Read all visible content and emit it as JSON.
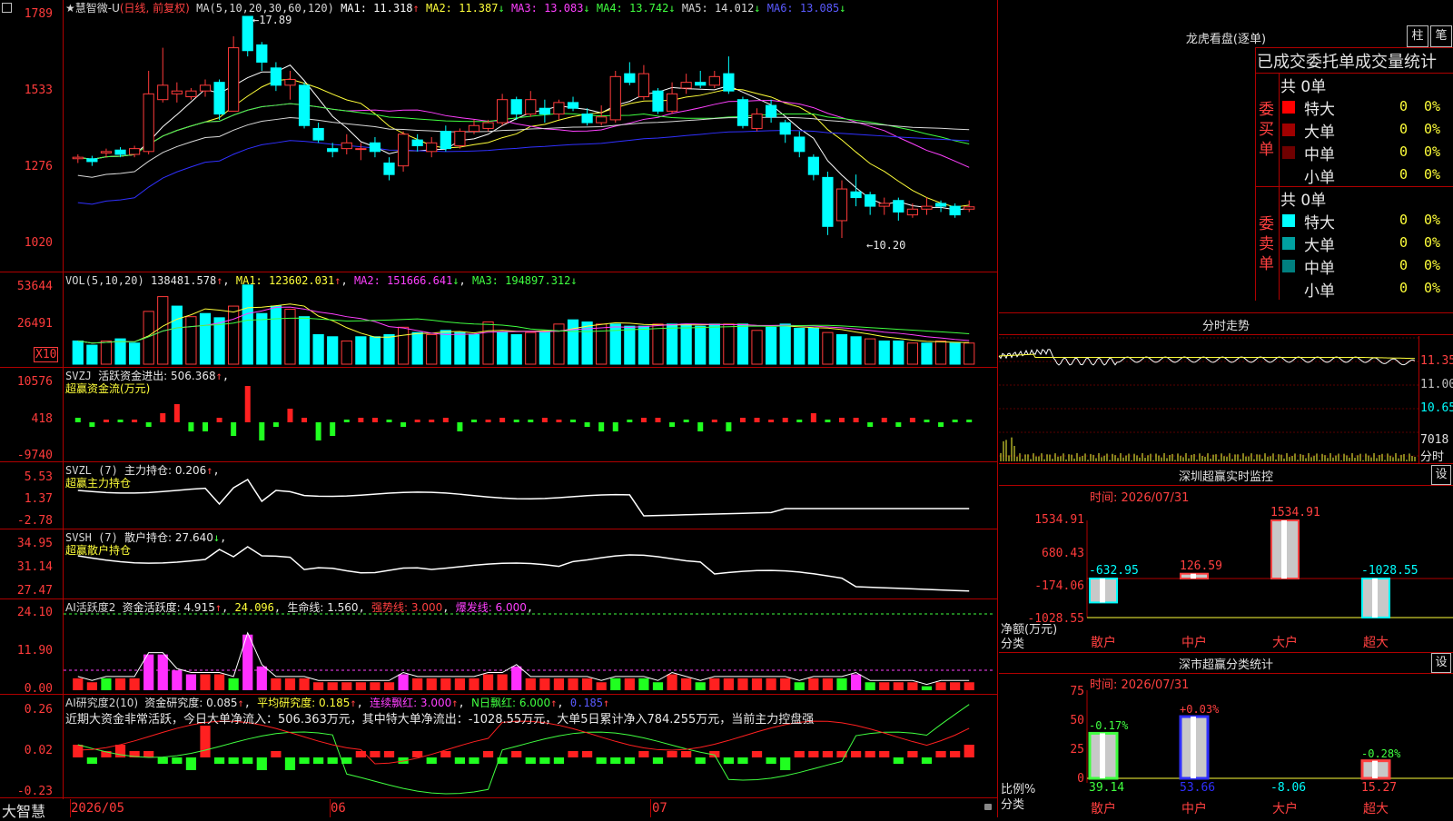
{
  "main": {
    "stock_title": "★慧智微-U",
    "stock_mode": "(日线, 前复权)",
    "ma_header": "MA(5,10,20,30,60,120)",
    "ma_values": [
      {
        "label": "MA1: 11.318",
        "arrow": "↑",
        "color": "#ffffff"
      },
      {
        "label": "MA2: 11.387",
        "arrow": "↓",
        "color": "#ffff3a"
      },
      {
        "label": "MA3: 13.083",
        "arrow": "↓",
        "color": "#ff40ff"
      },
      {
        "label": "MA4: 13.742",
        "arrow": "↓",
        "color": "#40ff40"
      },
      {
        "label": "MA5: 14.012",
        "arrow": "↓",
        "color": "#d8d8d8"
      },
      {
        "label": "MA6: 13.085",
        "arrow": "↓",
        "color": "#5a5aff"
      }
    ],
    "y_ticks": [
      "1789",
      "1533",
      "1276",
      "1020"
    ],
    "high_marker": "←17.89",
    "low_marker": "←10.20",
    "candles": [
      {
        "o": 12.95,
        "c": 13.0,
        "h": 13.1,
        "l": 12.8
      },
      {
        "o": 12.95,
        "c": 12.85,
        "h": 13.05,
        "l": 12.7
      },
      {
        "o": 13.15,
        "c": 13.2,
        "h": 13.3,
        "l": 13.0
      },
      {
        "o": 13.25,
        "c": 13.1,
        "h": 13.35,
        "l": 13.0
      },
      {
        "o": 13.1,
        "c": 13.3,
        "h": 13.4,
        "l": 13.0
      },
      {
        "o": 13.2,
        "c": 15.2,
        "h": 16.0,
        "l": 13.1
      },
      {
        "o": 15.0,
        "c": 15.5,
        "h": 16.8,
        "l": 14.9
      },
      {
        "o": 15.2,
        "c": 15.3,
        "h": 15.6,
        "l": 14.9
      },
      {
        "o": 15.1,
        "c": 15.3,
        "h": 15.4,
        "l": 15.0
      },
      {
        "o": 15.3,
        "c": 15.5,
        "h": 15.7,
        "l": 15.1
      },
      {
        "o": 15.6,
        "c": 14.5,
        "h": 15.7,
        "l": 14.3
      },
      {
        "o": 14.6,
        "c": 16.8,
        "h": 17.2,
        "l": 14.6
      },
      {
        "o": 17.89,
        "c": 16.7,
        "h": 17.89,
        "l": 16.5
      },
      {
        "o": 16.9,
        "c": 16.3,
        "h": 17.0,
        "l": 16.0
      },
      {
        "o": 16.1,
        "c": 15.5,
        "h": 16.3,
        "l": 15.3
      },
      {
        "o": 15.5,
        "c": 15.7,
        "h": 16.0,
        "l": 15.0
      },
      {
        "o": 15.5,
        "c": 14.1,
        "h": 15.6,
        "l": 14.0
      },
      {
        "o": 14.0,
        "c": 13.6,
        "h": 14.2,
        "l": 13.5
      },
      {
        "o": 13.3,
        "c": 13.2,
        "h": 13.5,
        "l": 13.0
      },
      {
        "o": 13.3,
        "c": 13.5,
        "h": 13.8,
        "l": 13.1
      },
      {
        "o": 13.3,
        "c": 13.3,
        "h": 13.5,
        "l": 12.9
      },
      {
        "o": 13.5,
        "c": 13.2,
        "h": 13.7,
        "l": 13.0
      },
      {
        "o": 12.8,
        "c": 12.4,
        "h": 13.0,
        "l": 12.2
      },
      {
        "o": 12.7,
        "c": 13.8,
        "h": 13.9,
        "l": 12.5
      },
      {
        "o": 13.6,
        "c": 13.4,
        "h": 13.8,
        "l": 13.2
      },
      {
        "o": 13.2,
        "c": 13.5,
        "h": 13.7,
        "l": 13.0
      },
      {
        "o": 13.9,
        "c": 13.3,
        "h": 14.1,
        "l": 13.2
      },
      {
        "o": 13.4,
        "c": 13.9,
        "h": 14.0,
        "l": 13.3
      },
      {
        "o": 13.9,
        "c": 14.1,
        "h": 14.3,
        "l": 13.8
      },
      {
        "o": 14.0,
        "c": 14.2,
        "h": 14.3,
        "l": 13.9
      },
      {
        "o": 14.2,
        "c": 15.0,
        "h": 15.2,
        "l": 14.1
      },
      {
        "o": 15.0,
        "c": 14.5,
        "h": 15.1,
        "l": 14.3
      },
      {
        "o": 14.5,
        "c": 15.0,
        "h": 15.3,
        "l": 14.4
      },
      {
        "o": 14.7,
        "c": 14.5,
        "h": 15.0,
        "l": 14.2
      },
      {
        "o": 14.5,
        "c": 14.9,
        "h": 15.0,
        "l": 14.3
      },
      {
        "o": 14.9,
        "c": 14.7,
        "h": 15.1,
        "l": 14.6
      },
      {
        "o": 14.5,
        "c": 14.2,
        "h": 14.7,
        "l": 14.1
      },
      {
        "o": 14.2,
        "c": 14.4,
        "h": 14.8,
        "l": 14.1
      },
      {
        "o": 14.3,
        "c": 15.8,
        "h": 16.0,
        "l": 14.2
      },
      {
        "o": 15.9,
        "c": 15.6,
        "h": 16.3,
        "l": 15.5
      },
      {
        "o": 15.1,
        "c": 15.9,
        "h": 16.2,
        "l": 15.0
      },
      {
        "o": 15.3,
        "c": 14.6,
        "h": 15.4,
        "l": 14.5
      },
      {
        "o": 14.6,
        "c": 15.2,
        "h": 15.6,
        "l": 14.5
      },
      {
        "o": 15.4,
        "c": 15.6,
        "h": 15.9,
        "l": 15.2
      },
      {
        "o": 15.6,
        "c": 15.5,
        "h": 16.0,
        "l": 15.4
      },
      {
        "o": 15.5,
        "c": 15.8,
        "h": 16.0,
        "l": 15.4
      },
      {
        "o": 15.9,
        "c": 15.3,
        "h": 16.5,
        "l": 15.2
      },
      {
        "o": 15.0,
        "c": 14.1,
        "h": 15.1,
        "l": 14.0
      },
      {
        "o": 14.0,
        "c": 14.5,
        "h": 14.7,
        "l": 13.9
      },
      {
        "o": 14.8,
        "c": 14.4,
        "h": 15.0,
        "l": 14.2
      },
      {
        "o": 14.2,
        "c": 13.8,
        "h": 14.3,
        "l": 13.5
      },
      {
        "o": 13.7,
        "c": 13.2,
        "h": 13.9,
        "l": 13.0
      },
      {
        "o": 13.0,
        "c": 12.4,
        "h": 13.1,
        "l": 12.2
      },
      {
        "o": 12.3,
        "c": 10.6,
        "h": 12.5,
        "l": 10.3
      },
      {
        "o": 10.8,
        "c": 11.9,
        "h": 12.2,
        "l": 10.2
      },
      {
        "o": 11.8,
        "c": 11.6,
        "h": 12.4,
        "l": 11.3
      },
      {
        "o": 11.7,
        "c": 11.3,
        "h": 11.8,
        "l": 11.0
      },
      {
        "o": 11.3,
        "c": 11.4,
        "h": 11.6,
        "l": 11.0
      },
      {
        "o": 11.5,
        "c": 11.1,
        "h": 11.6,
        "l": 10.8
      },
      {
        "o": 11.0,
        "c": 11.2,
        "h": 11.4,
        "l": 10.9
      },
      {
        "o": 11.2,
        "c": 11.3,
        "h": 11.6,
        "l": 11.0
      },
      {
        "o": 11.4,
        "c": 11.3,
        "h": 11.5,
        "l": 11.1
      },
      {
        "o": 11.3,
        "c": 11.0,
        "h": 11.4,
        "l": 10.9
      },
      {
        "o": 11.2,
        "c": 11.28,
        "h": 11.5,
        "l": 11.1
      }
    ]
  },
  "vol": {
    "header": "VOL(5,10,20)",
    "value": "138481.578",
    "value_arrow": "↑",
    "ma1": "MA1: 123602.031",
    "ma1_arrow": "↑",
    "ma2": "MA2: 151666.641",
    "ma2_arrow": "↓",
    "ma3": "MA3: 194897.312",
    "ma3_arrow": "↓",
    "y_ticks": [
      "53644",
      "26491"
    ],
    "unit": "X10",
    "bars": [
      22,
      18,
      22,
      24,
      20,
      50,
      64,
      55,
      45,
      48,
      44,
      55,
      75,
      48,
      55,
      52,
      45,
      28,
      26,
      22,
      26,
      26,
      28,
      35,
      30,
      28,
      32,
      30,
      28,
      40,
      30,
      28,
      30,
      30,
      38,
      42,
      40,
      38,
      38,
      36,
      36,
      38,
      38,
      38,
      36,
      38,
      38,
      38,
      32,
      35,
      38,
      34,
      34,
      30,
      28,
      26,
      24,
      22,
      22,
      20,
      20,
      22,
      20,
      20
    ],
    "bar_colors": [
      "c",
      "c",
      "r",
      "c",
      "c",
      "r",
      "r",
      "c",
      "r",
      "c",
      "c",
      "r",
      "c",
      "c",
      "c",
      "r",
      "c",
      "c",
      "c",
      "r",
      "c",
      "c",
      "c",
      "r",
      "c",
      "r",
      "c",
      "c",
      "c",
      "r",
      "c",
      "c",
      "r",
      "c",
      "r",
      "c",
      "c",
      "r",
      "c",
      "c",
      "c",
      "r",
      "c",
      "c",
      "c",
      "c",
      "r",
      "c",
      "r",
      "c",
      "c",
      "c",
      "c",
      "r",
      "c",
      "c",
      "r",
      "c",
      "c",
      "r",
      "c",
      "r",
      "c",
      "r"
    ]
  },
  "svzj": {
    "header": "SVZJ",
    "label": "活跃资金进出: 506.368",
    "arrow": "↑",
    "sub": "超赢资金流(万元)",
    "y_ticks": [
      "10576",
      "418",
      "-9740"
    ],
    "values": [
      1,
      -1,
      0,
      0,
      0,
      -1,
      2,
      4,
      -2,
      -2,
      1,
      -3,
      8,
      -4,
      -1,
      3,
      1,
      -4,
      -3,
      0,
      1,
      1,
      0,
      -1,
      0,
      0,
      1,
      -2,
      0,
      0,
      1,
      0,
      0,
      1,
      0,
      0,
      -1,
      -2,
      -2,
      0,
      1,
      1,
      -1,
      0,
      -2,
      0,
      -2,
      1,
      1,
      0,
      1,
      0,
      2,
      0,
      1,
      1,
      -1,
      1,
      -1,
      1,
      0,
      -1,
      0,
      0
    ],
    "colors": [
      "g",
      "g",
      "r",
      "g",
      "r",
      "g",
      "r",
      "r",
      "g",
      "g",
      "r",
      "g",
      "r",
      "g",
      "g",
      "r",
      "r",
      "g",
      "g",
      "g",
      "r",
      "r",
      "g",
      "g",
      "r",
      "r",
      "r",
      "g",
      "g",
      "r",
      "r",
      "g",
      "g",
      "r",
      "r",
      "g",
      "g",
      "g",
      "g",
      "g",
      "r",
      "r",
      "g",
      "g",
      "g",
      "r",
      "g",
      "r",
      "r",
      "r",
      "r",
      "g",
      "r",
      "g",
      "r",
      "r",
      "g",
      "r",
      "g",
      "r",
      "g",
      "g",
      "g",
      "g"
    ]
  },
  "svzl": {
    "header": "SVZL (7)",
    "label": "主力持仓: 0.206",
    "arrow": "↑",
    "sub": "超赢主力持仓",
    "y_ticks": [
      "5.53",
      "1.37",
      "-2.78"
    ]
  },
  "svsh": {
    "header": "SVSH (7)",
    "label": "散户持仓: 27.640",
    "arrow": "↓",
    "sub": "超赢散户持仓",
    "y_ticks": [
      "34.95",
      "31.14",
      "27.47"
    ]
  },
  "ai_active": {
    "header": "AI活跃度2",
    "label": "资金活跃度: 4.915",
    "arrow": "↑",
    "v2": "24.096",
    "life": "生命线: 1.560",
    "strong": "强势线: 3.000",
    "burst": "爆发线: 6.000",
    "y_ticks": [
      "24.10",
      "11.90",
      "0.00"
    ],
    "values": [
      3,
      2,
      3,
      3,
      3,
      9,
      9,
      5,
      4,
      4,
      4,
      3,
      14,
      6,
      3,
      3,
      3,
      2,
      2,
      2,
      2,
      2,
      2,
      4,
      3,
      3,
      3,
      3,
      3,
      4,
      4,
      6,
      3,
      3,
      3,
      3,
      3,
      2,
      3,
      3,
      3,
      2,
      4,
      3,
      2,
      3,
      3,
      3,
      3,
      3,
      3,
      2,
      3,
      3,
      3,
      4,
      2,
      2,
      2,
      2,
      1,
      2,
      2,
      2
    ],
    "colors": [
      "r",
      "r",
      "g",
      "r",
      "r",
      "m",
      "m",
      "m",
      "m",
      "r",
      "r",
      "g",
      "m",
      "m",
      "r",
      "r",
      "r",
      "r",
      "r",
      "r",
      "r",
      "r",
      "r",
      "m",
      "r",
      "r",
      "r",
      "r",
      "r",
      "r",
      "r",
      "m",
      "r",
      "r",
      "r",
      "r",
      "r",
      "r",
      "g",
      "r",
      "g",
      "g",
      "r",
      "r",
      "g",
      "r",
      "r",
      "r",
      "r",
      "r",
      "r",
      "g",
      "r",
      "r",
      "g",
      "m",
      "g",
      "r",
      "r",
      "r",
      "g",
      "r",
      "r",
      "r"
    ]
  },
  "ai_research": {
    "header": "AI研究度2(10)",
    "label": "资金研究度: 0.085",
    "arrow": "↑",
    "avg": "平均研究度: 0.185",
    "avg_arrow": "↑",
    "cont": "连续飘红: 3.000",
    "cont_arrow": "↑",
    "nday": "N日飘红: 6.000",
    "nday_arrow": "↑",
    "last": "0.185",
    "last_arrow": "↑",
    "y_ticks": [
      "0.26",
      "0.02",
      "-0.23"
    ],
    "summary": "近期大资金非常活跃，今日大单净流入：506.363万元，其中特大单净流出：-1028.55万元，大单5日累计净入784.255万元，当前主力控盘强",
    "values": [
      2,
      -1,
      1,
      2,
      1,
      1,
      -1,
      -1,
      -2,
      5,
      -1,
      -1,
      -1,
      -2,
      1,
      -2,
      -1,
      -1,
      -1,
      -1,
      1,
      1,
      1,
      -1,
      1,
      -1,
      1,
      -1,
      -1,
      1,
      -1,
      1,
      -1,
      -1,
      -1,
      1,
      1,
      -1,
      -1,
      -1,
      1,
      -1,
      1,
      1,
      -1,
      1,
      -1,
      -1,
      1,
      -1,
      -2,
      1,
      1,
      1,
      1,
      1,
      1,
      1,
      -1,
      1,
      -1,
      1,
      1,
      2
    ]
  },
  "dates": [
    "2026/05",
    "06",
    "07"
  ],
  "footer_left": "大智慧",
  "right": {
    "dragon_title": "龙虎看盘(逐单)",
    "btn_bar": "柱",
    "btn_stroke": "笔",
    "stat_title": "已成交委托单成交量统计",
    "buy_total": "共 0单",
    "buy_label": "委买单",
    "sell_total": "共 0单",
    "sell_label": "委卖单",
    "buy_rows": [
      {
        "name": "特大",
        "qty": "0",
        "pct": "0%",
        "color": "#ff0000"
      },
      {
        "name": "大单",
        "qty": "0",
        "pct": "0%",
        "color": "#a00000"
      },
      {
        "name": "中单",
        "qty": "0",
        "pct": "0%",
        "color": "#700000"
      },
      {
        "name": "小单",
        "qty": "0",
        "pct": "0%",
        "color": ""
      }
    ],
    "sell_rows": [
      {
        "name": "特大",
        "qty": "0",
        "pct": "0%",
        "color": "#00ffff"
      },
      {
        "name": "大单",
        "qty": "0",
        "pct": "0%",
        "color": "#00a0a0"
      },
      {
        "name": "中单",
        "qty": "0",
        "pct": "0%",
        "color": "#008080"
      },
      {
        "name": "小单",
        "qty": "0",
        "pct": "0%",
        "color": ""
      }
    ],
    "intraday_title": "分时走势",
    "intraday_ticks": [
      "11.35",
      "11.00",
      "10.65",
      "7018"
    ],
    "intraday_unit": "分时",
    "sz_title": "深圳超赢实时监控",
    "sz_btn": "设",
    "sz_time": "时间: 2026/07/31",
    "sz_y_ticks": [
      "1534.91",
      "680.43",
      "-174.06",
      "-1028.55"
    ],
    "sz_axis_name": "净额(万元)",
    "sz_axis_sub": "分类",
    "sz_bars": [
      {
        "cat": "散户",
        "value": -632.95,
        "label": "-632.95",
        "color": "#00ffff"
      },
      {
        "cat": "中户",
        "value": 126.59,
        "label": "126.59",
        "color": "#ff4040"
      },
      {
        "cat": "大户",
        "value": 1534.91,
        "label": "1534.91",
        "color": "#ff4040"
      },
      {
        "cat": "超大",
        "value": -1028.55,
        "label": "-1028.55",
        "color": "#00ffff"
      }
    ],
    "sh_title": "深市超赢分类统计",
    "sh_btn": "设",
    "sh_time": "时间: 2026/07/31",
    "sh_y_ticks": [
      "75",
      "50",
      "25",
      "0"
    ],
    "sh_axis_name": "比例%",
    "sh_axis_sub": "分类",
    "sh_bars": [
      {
        "cat": "散户",
        "value": 39.14,
        "label": "39.14",
        "chg": "-0.17%",
        "color": "#40ff40",
        "chgcolor": "#40ff40"
      },
      {
        "cat": "中户",
        "value": 53.66,
        "label": "53.66",
        "chg": "+0.03%",
        "color": "#3030ff",
        "chgcolor": "#ff4040"
      },
      {
        "cat": "大户",
        "value": -8.06,
        "label": "-8.06",
        "chg": "",
        "color": "#00ffff",
        "chgcolor": "#00ffff"
      },
      {
        "cat": "超大",
        "value": 15.27,
        "label": "15.27",
        "chg": "-0.28%",
        "color": "#ff4040",
        "chgcolor": "#40ff40"
      }
    ]
  }
}
